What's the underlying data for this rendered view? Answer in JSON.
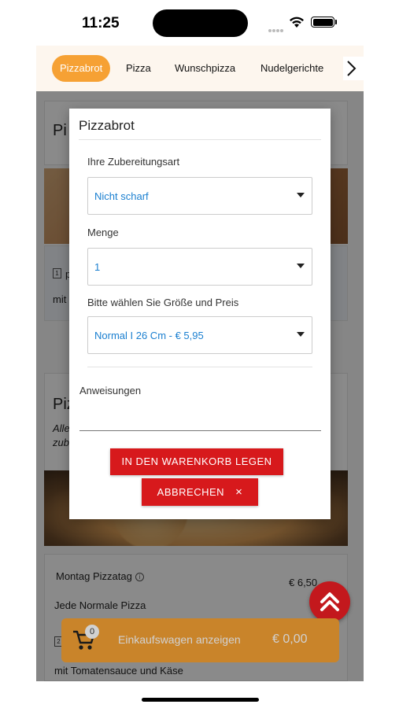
{
  "status_bar": {
    "time": "11:25"
  },
  "tabs": [
    {
      "label": "Pizzabrot",
      "active": true
    },
    {
      "label": "Pizza",
      "active": false
    },
    {
      "label": "Wunschpizza",
      "active": false
    },
    {
      "label": "Nudelgerichte",
      "active": false
    }
  ],
  "background": {
    "section1_title": "Pi",
    "qty1": "1",
    "row1_text_fragment": "p",
    "row1_subtext": "mit",
    "section2_title": "Piz",
    "section2_desc_line1": "Alle",
    "section2_desc_line2": "zub",
    "product_name": "Montag Pizzatag",
    "product_price": "€ 6,50",
    "product_subtitle": "Jede Normale Pizza",
    "qty2": "2",
    "bottom_text": "mit Tomatensauce und Käse"
  },
  "cart": {
    "count": "0",
    "label": "Einkaufswagen anzeigen",
    "total": "€ 0,00"
  },
  "modal": {
    "title": "Pizzabrot",
    "prep_label": "Ihre Zubereitungsart",
    "prep_value": "Nicht scharf",
    "qty_label": "Menge",
    "qty_value": "1",
    "size_label": "Bitte wählen Sie Größe und Preis",
    "size_value": "Normal I 26 Cm - € 5,95",
    "instructions_label": "Anweisungen",
    "instructions_value": "",
    "add_button": "IN DEN WARENKORB LEGEN",
    "cancel_button": "ABBRECHEN",
    "cancel_icon": "×"
  },
  "colors": {
    "accent_orange": "#f6a134",
    "button_red": "#d7191c",
    "link_blue": "#1a7fd0"
  },
  "icons": [
    "wifi-icon",
    "battery-icon",
    "chevron-right-icon",
    "cart-icon",
    "double-chevron-up-icon",
    "close-icon",
    "info-icon"
  ]
}
